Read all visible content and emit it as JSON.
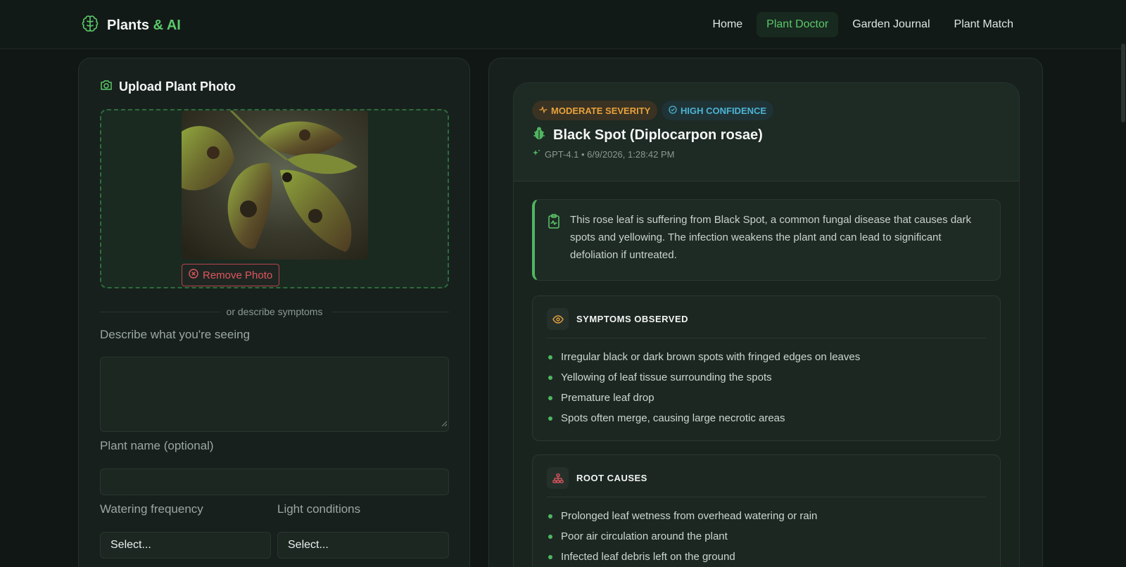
{
  "brand": {
    "name": "Plants",
    "accent": " & AI"
  },
  "nav": [
    {
      "label": "Home",
      "active": false
    },
    {
      "label": "Plant Doctor",
      "active": true
    },
    {
      "label": "Garden Journal",
      "active": false
    },
    {
      "label": "Plant Match",
      "active": false
    }
  ],
  "upload": {
    "title": "Upload Plant Photo",
    "remove_label": "Remove Photo",
    "divider_text": "or describe symptoms"
  },
  "form": {
    "describe_label": "Describe what you're seeing",
    "plant_name_label": "Plant name (optional)",
    "watering_label": "Watering frequency",
    "light_label": "Light conditions",
    "watering_value": "Select...",
    "light_value": "Select..."
  },
  "diagnosis": {
    "severity_badge": "MODERATE SEVERITY",
    "confidence_badge": "HIGH CONFIDENCE",
    "title": "Black Spot (Diplocarpon rosae)",
    "meta": "GPT-4.1 • 6/9/2026, 1:28:42 PM",
    "summary": "This rose leaf is suffering from Black Spot, a common fungal disease that causes dark spots and yellowing. The infection weakens the plant and can lead to significant defoliation if untreated.",
    "symptoms_title": "SYMPTOMS OBSERVED",
    "symptoms": [
      "Irregular black or dark brown spots with fringed edges on leaves",
      "Yellowing of leaf tissue surrounding the spots",
      "Premature leaf drop",
      "Spots often merge, causing large necrotic areas"
    ],
    "causes_title": "ROOT CAUSES",
    "causes": [
      "Prolonged leaf wetness from overhead watering or rain",
      "Poor air circulation around the plant",
      "Infected leaf debris left on the ground"
    ]
  },
  "colors": {
    "accent": "#5cc86a",
    "severity": "#e8a23c",
    "confidence": "#4cb3d4",
    "danger": "#e0565e"
  }
}
